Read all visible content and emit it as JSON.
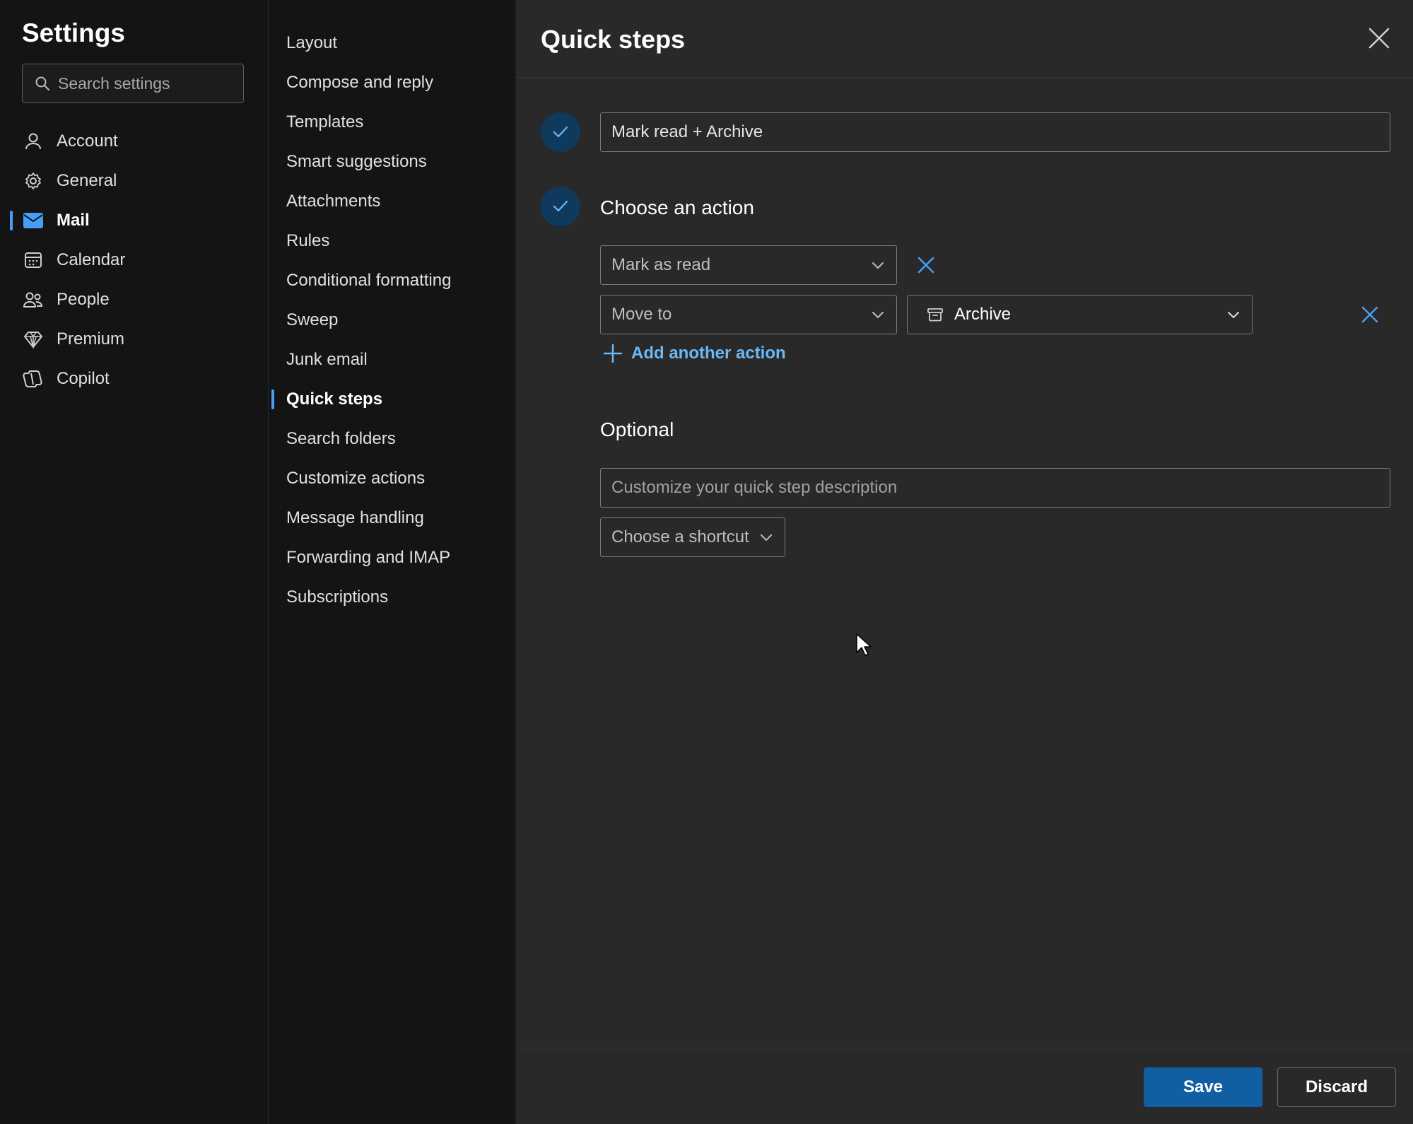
{
  "left": {
    "title": "Settings",
    "search_placeholder": "Search settings",
    "items": [
      {
        "label": "Account",
        "icon": "person-icon"
      },
      {
        "label": "General",
        "icon": "gear-icon"
      },
      {
        "label": "Mail",
        "icon": "mail-icon",
        "active": true
      },
      {
        "label": "Calendar",
        "icon": "calendar-icon"
      },
      {
        "label": "People",
        "icon": "people-icon"
      },
      {
        "label": "Premium",
        "icon": "diamond-icon"
      },
      {
        "label": "Copilot",
        "icon": "copilot-icon"
      }
    ]
  },
  "middle": {
    "items": [
      "Layout",
      "Compose and reply",
      "Templates",
      "Smart suggestions",
      "Attachments",
      "Rules",
      "Conditional formatting",
      "Sweep",
      "Junk email",
      "Quick steps",
      "Search folders",
      "Customize actions",
      "Message handling",
      "Forwarding and IMAP",
      "Subscriptions"
    ],
    "active": "Quick steps"
  },
  "panel": {
    "title": "Quick steps",
    "name_value": "Mark read + Archive",
    "choose_action_heading": "Choose an action",
    "action1": "Mark as read",
    "action2": "Move to",
    "action2_target": "Archive",
    "add_action_label": "Add another action",
    "optional_heading": "Optional",
    "description_placeholder": "Customize your quick step description",
    "shortcut_placeholder": "Choose a shortcut",
    "save_label": "Save",
    "discard_label": "Discard"
  },
  "colors": {
    "accent": "#479ef5",
    "link": "#6cb8f6",
    "primary_button": "#115ea3",
    "step_circle": "#0f3a5e"
  }
}
